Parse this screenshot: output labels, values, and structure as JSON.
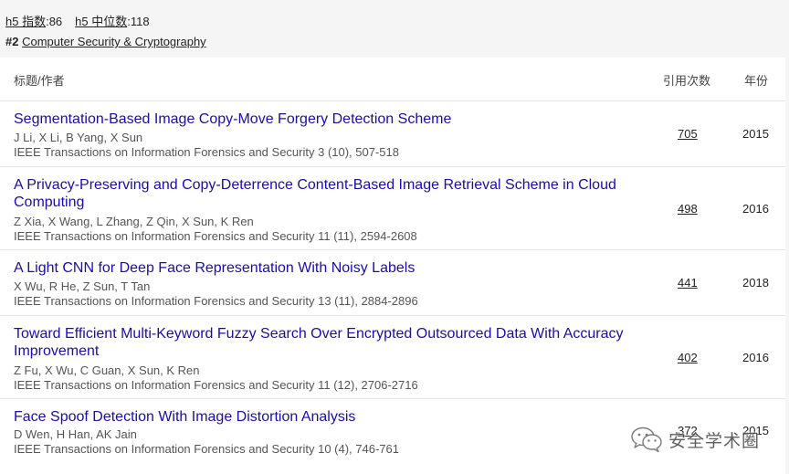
{
  "metrics": {
    "h5_index_label": "h5 指数",
    "h5_index_value": ":86",
    "h5_median_label": "h5 中位数",
    "h5_median_value": ":118"
  },
  "category": {
    "rank": "#2",
    "name": "Computer Security & Cryptography"
  },
  "table": {
    "headers": {
      "title_author": "标题/作者",
      "citations": "引用次数",
      "year": "年份"
    },
    "rows": [
      {
        "title": "Segmentation-Based Image Copy-Move Forgery Detection Scheme",
        "authors": "J Li, X Li, B Yang, X Sun",
        "venue": "IEEE Transactions on Information Forensics and Security 3 (10), 507-518",
        "citations": "705",
        "year": "2015"
      },
      {
        "title": "A Privacy-Preserving and Copy-Deterrence Content-Based Image Retrieval Scheme in Cloud Computing",
        "authors": "Z Xia, X Wang, L Zhang, Z Qin, X Sun, K Ren",
        "venue": "IEEE Transactions on Information Forensics and Security 11 (11), 2594-2608",
        "citations": "498",
        "year": "2016"
      },
      {
        "title": "A Light CNN for Deep Face Representation With Noisy Labels",
        "authors": "X Wu, R He, Z Sun, T Tan",
        "venue": "IEEE Transactions on Information Forensics and Security 13 (11), 2884-2896",
        "citations": "441",
        "year": "2018"
      },
      {
        "title": "Toward Efficient Multi-Keyword Fuzzy Search Over Encrypted Outsourced Data With Accuracy Improvement",
        "authors": "Z Fu, X Wu, C Guan, X Sun, K Ren",
        "venue": "IEEE Transactions on Information Forensics and Security 11 (12), 2706-2716",
        "citations": "402",
        "year": "2016"
      },
      {
        "title": "Face Spoof Detection With Image Distortion Analysis",
        "authors": "D Wen, H Han, AK Jain",
        "venue": "IEEE Transactions on Information Forensics and Security 10 (4), 746-761",
        "citations": "372",
        "year": "2015"
      }
    ]
  },
  "watermark": {
    "text": "安全学术圈",
    "icon": "wechat-icon"
  }
}
